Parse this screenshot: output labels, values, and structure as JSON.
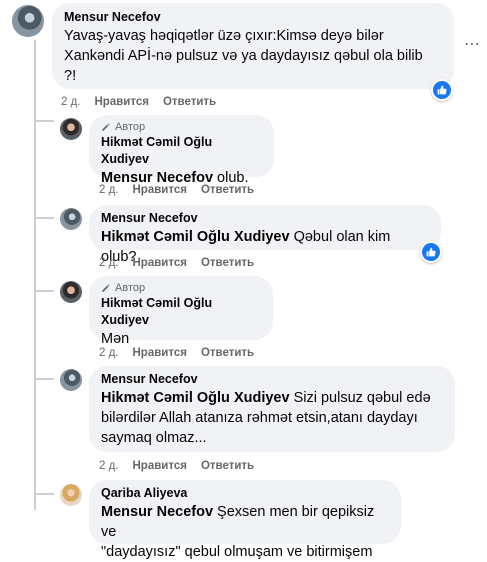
{
  "actions": {
    "like": "Нравится",
    "reply": "Ответить"
  },
  "author_badge": "Автор",
  "colors": {
    "accent": "#1877f2",
    "bubble": "#f0f2f5",
    "meta": "#65676b"
  },
  "icons": {
    "author": "pen-icon",
    "like": "thumbs-up-icon",
    "more": "more-dots-icon"
  },
  "comments": [
    {
      "author": "Mensur Necefov",
      "line1": "Yavaş-yavaş həqiqətlər üzə çıxır:Kimsə deyə bilər",
      "line2": "Xankəndi APİ-nə pulsuz və ya daydayısız qəbul ola bilib",
      "line3": "?!",
      "time": "2 д.",
      "liked": true
    },
    {
      "author": "Hikmət Cəmil Oğlu Xudiyev",
      "is_author": true,
      "mention": "Mensur Necefov",
      "text": "olub.",
      "time": "2 д."
    },
    {
      "author": "Mensur Necefov",
      "mention": "Hikmət Cəmil Oğlu Xudiyev",
      "text": "Qəbul olan kim olub?",
      "time": "2 д.",
      "liked": true
    },
    {
      "author": "Hikmət Cəmil Oğlu Xudiyev",
      "is_author": true,
      "text": "Mən",
      "time": "2 д."
    },
    {
      "author": "Mensur Necefov",
      "mention": "Hikmət Cəmil Oğlu Xudiyev",
      "text_line1": "Sizi pulsuz qəbul edə",
      "line2": "bilərdilər Allah atanıza rəhmət etsin,atanı daydayı",
      "line3": "saymaq olmaz...",
      "time": "2 д."
    },
    {
      "author": "Qariba Aliyeva",
      "mention": "Mensur Necefov",
      "text_line1": "Şexsen men bir qepiksiz ve",
      "line2": "\"daydayısız\" qebul olmuşam ve bitirmişem"
    }
  ]
}
